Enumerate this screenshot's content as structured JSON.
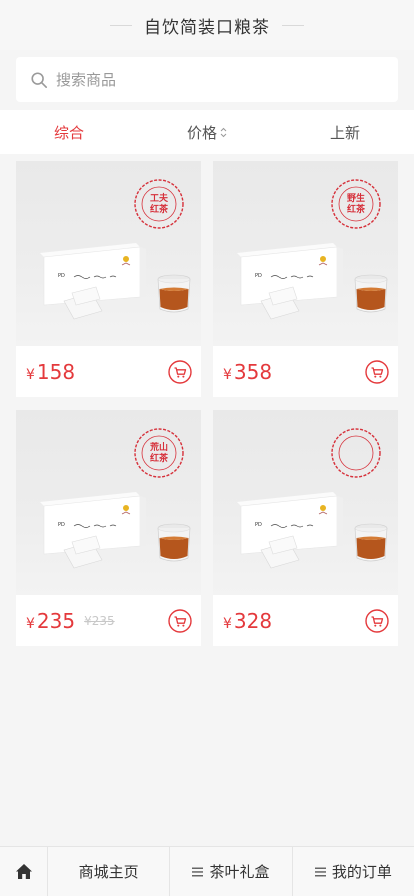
{
  "header": {
    "title": "自饮简装口粮茶"
  },
  "search": {
    "placeholder": "搜索商品"
  },
  "sort": {
    "items": [
      {
        "label": "综合",
        "active": true
      },
      {
        "label": "价格",
        "active": false
      },
      {
        "label": "上新",
        "active": false
      }
    ]
  },
  "products": [
    {
      "seal": "工夫\n红茶",
      "currency": "¥",
      "price": "158",
      "old_price": ""
    },
    {
      "seal": "野生\n红茶",
      "currency": "¥",
      "price": "358",
      "old_price": ""
    },
    {
      "seal": "荒山\n红茶",
      "currency": "¥",
      "price": "235",
      "old_price": "¥235"
    },
    {
      "seal": "",
      "currency": "¥",
      "price": "328",
      "old_price": ""
    }
  ],
  "colors": {
    "accent": "#e4393c"
  },
  "bottom_nav": {
    "home_icon": "home-icon",
    "items": [
      {
        "label": "商城主页"
      },
      {
        "label": "茶叶礼盒"
      },
      {
        "label": "我的订单"
      }
    ]
  }
}
